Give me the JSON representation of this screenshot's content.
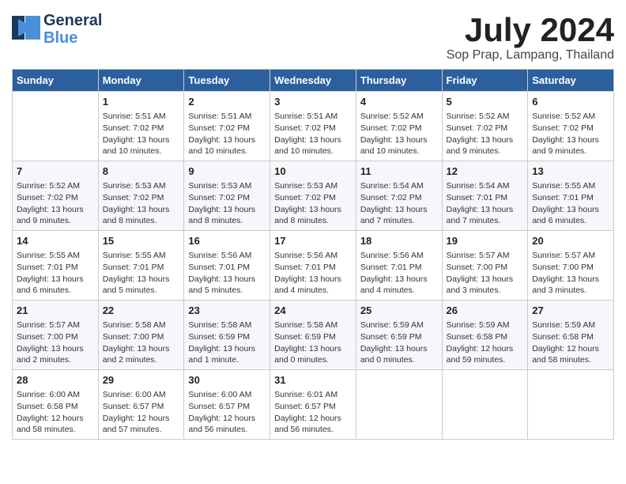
{
  "logo": {
    "part1": "General",
    "part2": "Blue"
  },
  "title": "July 2024",
  "location": "Sop Prap, Lampang, Thailand",
  "weekdays": [
    "Sunday",
    "Monday",
    "Tuesday",
    "Wednesday",
    "Thursday",
    "Friday",
    "Saturday"
  ],
  "weeks": [
    [
      {
        "day": "",
        "info": ""
      },
      {
        "day": "1",
        "info": "Sunrise: 5:51 AM\nSunset: 7:02 PM\nDaylight: 13 hours\nand 10 minutes."
      },
      {
        "day": "2",
        "info": "Sunrise: 5:51 AM\nSunset: 7:02 PM\nDaylight: 13 hours\nand 10 minutes."
      },
      {
        "day": "3",
        "info": "Sunrise: 5:51 AM\nSunset: 7:02 PM\nDaylight: 13 hours\nand 10 minutes."
      },
      {
        "day": "4",
        "info": "Sunrise: 5:52 AM\nSunset: 7:02 PM\nDaylight: 13 hours\nand 10 minutes."
      },
      {
        "day": "5",
        "info": "Sunrise: 5:52 AM\nSunset: 7:02 PM\nDaylight: 13 hours\nand 9 minutes."
      },
      {
        "day": "6",
        "info": "Sunrise: 5:52 AM\nSunset: 7:02 PM\nDaylight: 13 hours\nand 9 minutes."
      }
    ],
    [
      {
        "day": "7",
        "info": "Sunrise: 5:52 AM\nSunset: 7:02 PM\nDaylight: 13 hours\nand 9 minutes."
      },
      {
        "day": "8",
        "info": "Sunrise: 5:53 AM\nSunset: 7:02 PM\nDaylight: 13 hours\nand 8 minutes."
      },
      {
        "day": "9",
        "info": "Sunrise: 5:53 AM\nSunset: 7:02 PM\nDaylight: 13 hours\nand 8 minutes."
      },
      {
        "day": "10",
        "info": "Sunrise: 5:53 AM\nSunset: 7:02 PM\nDaylight: 13 hours\nand 8 minutes."
      },
      {
        "day": "11",
        "info": "Sunrise: 5:54 AM\nSunset: 7:02 PM\nDaylight: 13 hours\nand 7 minutes."
      },
      {
        "day": "12",
        "info": "Sunrise: 5:54 AM\nSunset: 7:01 PM\nDaylight: 13 hours\nand 7 minutes."
      },
      {
        "day": "13",
        "info": "Sunrise: 5:55 AM\nSunset: 7:01 PM\nDaylight: 13 hours\nand 6 minutes."
      }
    ],
    [
      {
        "day": "14",
        "info": "Sunrise: 5:55 AM\nSunset: 7:01 PM\nDaylight: 13 hours\nand 6 minutes."
      },
      {
        "day": "15",
        "info": "Sunrise: 5:55 AM\nSunset: 7:01 PM\nDaylight: 13 hours\nand 5 minutes."
      },
      {
        "day": "16",
        "info": "Sunrise: 5:56 AM\nSunset: 7:01 PM\nDaylight: 13 hours\nand 5 minutes."
      },
      {
        "day": "17",
        "info": "Sunrise: 5:56 AM\nSunset: 7:01 PM\nDaylight: 13 hours\nand 4 minutes."
      },
      {
        "day": "18",
        "info": "Sunrise: 5:56 AM\nSunset: 7:01 PM\nDaylight: 13 hours\nand 4 minutes."
      },
      {
        "day": "19",
        "info": "Sunrise: 5:57 AM\nSunset: 7:00 PM\nDaylight: 13 hours\nand 3 minutes."
      },
      {
        "day": "20",
        "info": "Sunrise: 5:57 AM\nSunset: 7:00 PM\nDaylight: 13 hours\nand 3 minutes."
      }
    ],
    [
      {
        "day": "21",
        "info": "Sunrise: 5:57 AM\nSunset: 7:00 PM\nDaylight: 13 hours\nand 2 minutes."
      },
      {
        "day": "22",
        "info": "Sunrise: 5:58 AM\nSunset: 7:00 PM\nDaylight: 13 hours\nand 2 minutes."
      },
      {
        "day": "23",
        "info": "Sunrise: 5:58 AM\nSunset: 6:59 PM\nDaylight: 13 hours\nand 1 minute."
      },
      {
        "day": "24",
        "info": "Sunrise: 5:58 AM\nSunset: 6:59 PM\nDaylight: 13 hours\nand 0 minutes."
      },
      {
        "day": "25",
        "info": "Sunrise: 5:59 AM\nSunset: 6:59 PM\nDaylight: 13 hours\nand 0 minutes."
      },
      {
        "day": "26",
        "info": "Sunrise: 5:59 AM\nSunset: 6:58 PM\nDaylight: 12 hours\nand 59 minutes."
      },
      {
        "day": "27",
        "info": "Sunrise: 5:59 AM\nSunset: 6:58 PM\nDaylight: 12 hours\nand 58 minutes."
      }
    ],
    [
      {
        "day": "28",
        "info": "Sunrise: 6:00 AM\nSunset: 6:58 PM\nDaylight: 12 hours\nand 58 minutes."
      },
      {
        "day": "29",
        "info": "Sunrise: 6:00 AM\nSunset: 6:57 PM\nDaylight: 12 hours\nand 57 minutes."
      },
      {
        "day": "30",
        "info": "Sunrise: 6:00 AM\nSunset: 6:57 PM\nDaylight: 12 hours\nand 56 minutes."
      },
      {
        "day": "31",
        "info": "Sunrise: 6:01 AM\nSunset: 6:57 PM\nDaylight: 12 hours\nand 56 minutes."
      },
      {
        "day": "",
        "info": ""
      },
      {
        "day": "",
        "info": ""
      },
      {
        "day": "",
        "info": ""
      }
    ]
  ]
}
